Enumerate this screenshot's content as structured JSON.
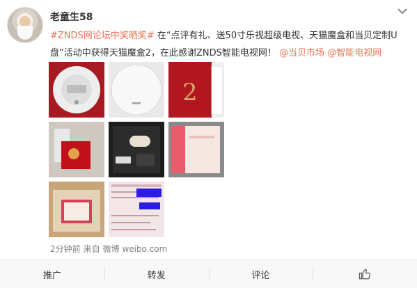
{
  "post": {
    "username": "老童生58",
    "topic": "#ZNDS网论坛中奖晒奖#",
    "text1": " 在“点评有礼、送50寸乐视超级电视、天猫魔盒和当贝定制U盘”活动中获得天猫魔盒2，在此感谢ZNDS智能电视网！ ",
    "mention1": "@当贝市场",
    "mention2": "@智能电视网",
    "time": "2分钟前",
    "source_prefix": "来自",
    "source": "微博 weibo.com"
  },
  "actions": {
    "share": "推广",
    "repost": "转发",
    "comment": "评论",
    "like_icon": "thumbs-up-icon"
  },
  "colors": {
    "link": "#eb7350",
    "meta": "#808080",
    "action_bg": "#f8f8f8"
  }
}
